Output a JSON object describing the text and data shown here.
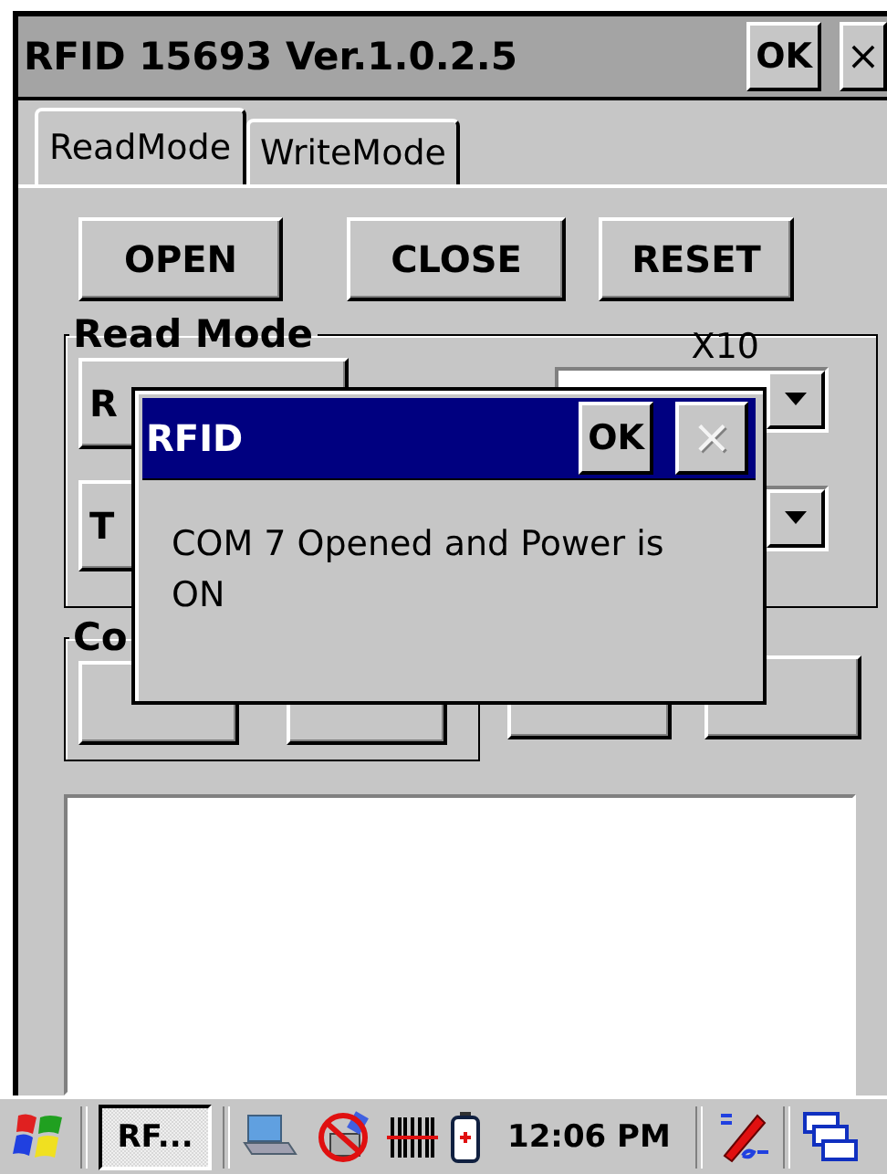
{
  "window": {
    "title": "RFID 15693 Ver.1.0.2.5",
    "ok": "OK",
    "close": "×"
  },
  "tabs": [
    {
      "label": "ReadMode",
      "selected": true
    },
    {
      "label": "WriteMode",
      "selected": false
    }
  ],
  "top_buttons": [
    "OPEN",
    "CLOSE",
    "RESET"
  ],
  "read_mode": {
    "label": "Read Mode",
    "buttons": [
      "R",
      "T"
    ],
    "multiplier_label": "X10",
    "dropdowns": [
      {
        "kind": "dropdown"
      },
      {
        "kind": "dropdown"
      }
    ]
  },
  "continuous": {
    "label": "Co",
    "buttons": [
      {
        "kind": "button"
      },
      {
        "kind": "button"
      }
    ]
  },
  "log_buttons": [
    {
      "kind": "button"
    },
    {
      "kind": "button"
    }
  ],
  "dialog": {
    "title": "RFID",
    "ok": "OK",
    "close": "×",
    "close_disabled": true,
    "message": "COM 7 Opened and Power is ON"
  },
  "taskbar": {
    "task": "RF...",
    "time": "12:06 PM"
  }
}
